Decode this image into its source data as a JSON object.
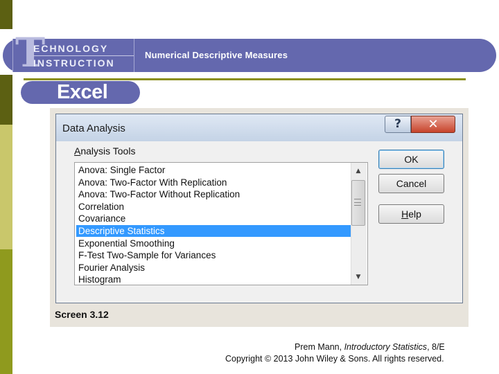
{
  "header": {
    "tech_letter": "T",
    "tech_line1": "ECHNOLOGY",
    "tech_line2": "INSTRUCTION",
    "title": "Numerical Descriptive Measures",
    "section": "Excel"
  },
  "dialog": {
    "title": "Data Analysis",
    "help_glyph": "?",
    "close_glyph": "✕",
    "tools_label_first": "A",
    "tools_label_rest": "nalysis Tools",
    "items": [
      "Anova: Single Factor",
      "Anova: Two-Factor With Replication",
      "Anova: Two-Factor Without Replication",
      "Correlation",
      "Covariance",
      "Descriptive Statistics",
      "Exponential Smoothing",
      "F-Test Two-Sample for Variances",
      "Fourier Analysis",
      "Histogram"
    ],
    "selected_item": "Descriptive Statistics",
    "ok_label": "OK",
    "cancel_label": "Cancel",
    "help_first": "H",
    "help_rest": "elp",
    "scroll_up": "▲",
    "scroll_down": "▼"
  },
  "caption": "Screen 3.12",
  "footer": {
    "author": "Prem Mann, ",
    "book": "Introductory Statistics",
    "edition": ", 8/E",
    "copyright": "Copyright © 2013 John Wiley & Sons. All rights reserved."
  },
  "colors": {
    "banner": "#6468ae",
    "olive": "#8a8f1a",
    "selection": "#3399ff"
  }
}
